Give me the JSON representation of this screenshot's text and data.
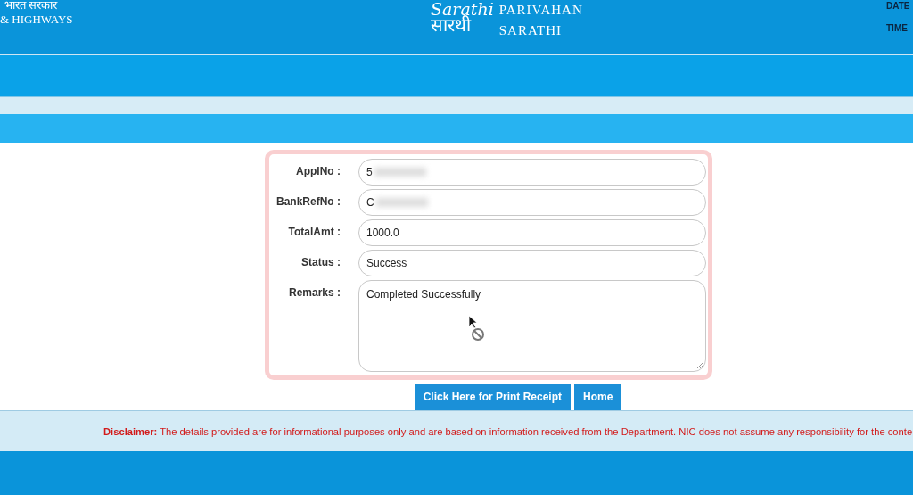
{
  "header": {
    "left_lines": [
      "भारत सरकार",
      "& HIGHWAYS"
    ],
    "logo": {
      "script_latin": "Sarathi",
      "script_devanagari": "सारथी",
      "lines": [
        "PARIVAHAN",
        "SARATHI"
      ]
    },
    "right_labels": [
      "DATE",
      "TIME"
    ]
  },
  "form": {
    "fields": [
      {
        "label": "ApplNo :",
        "value": "5",
        "kind": "input",
        "redacted": true
      },
      {
        "label": "BankRefNo :",
        "value": "C",
        "kind": "input",
        "redacted": true
      },
      {
        "label": "TotalAmt :",
        "value": "1000.0",
        "kind": "input",
        "redacted": false
      },
      {
        "label": "Status :",
        "value": "Success",
        "kind": "input",
        "redacted": false
      },
      {
        "label": "Remarks :",
        "value": "Completed Successfully",
        "kind": "textarea",
        "redacted": false
      }
    ]
  },
  "buttons": [
    "Click Here for Print Receipt",
    "Home"
  ],
  "disclaimer": {
    "lead": "Disclaimer:",
    "text": "The details provided are for informational purposes only and are based on information received from the Department. NIC does not assume any responsibility for the conte"
  }
}
